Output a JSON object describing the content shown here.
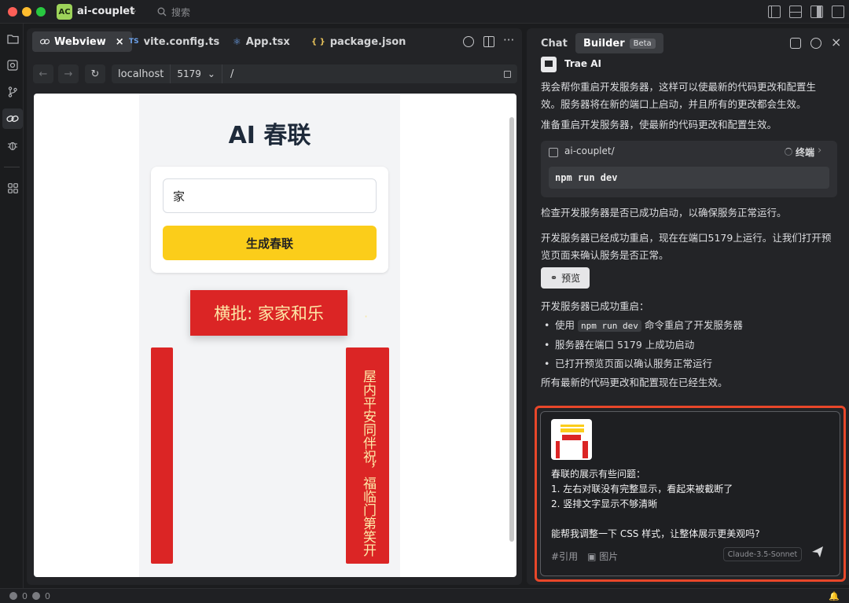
{
  "window": {
    "project_badge": "AC",
    "project_name": "ai-couplet",
    "search_placeholder": "搜索"
  },
  "editor": {
    "tabs": [
      {
        "label": "Webview",
        "icon": "link-icon",
        "active": true
      },
      {
        "label": "vite.config.ts",
        "icon": "ts-file-icon",
        "ext": "TS"
      },
      {
        "label": "App.tsx",
        "icon": "react-icon"
      },
      {
        "label": "package.json",
        "icon": "json-icon",
        "ext": "{ }"
      }
    ],
    "url": {
      "host": "localhost",
      "port": "5179",
      "path": "/"
    }
  },
  "webview": {
    "app_title": "AI 春联",
    "keyword_value": "家",
    "generate_label": "生成春联",
    "hengpi": "横批: 家家和乐",
    "right_couplet": "屋内平安同伴祝，福临门第笑开",
    "ghost_text": "·"
  },
  "panel": {
    "tab_chat": "Chat",
    "tab_builder": "Builder",
    "beta": "Beta",
    "sender": "Trae AI",
    "p1": "我会帮你重启开发服务器，这样可以使最新的代码更改和配置生效。服务器将在新的端口上启动，并且所有的更改都会生效。",
    "p2": "准备重启开发服务器，使最新的代码更改和配置生效。",
    "terminal": {
      "cwd": "ai-couplet/",
      "label": "终端",
      "command": "npm run dev"
    },
    "p3": "检查开发服务器是否已成功启动，以确保服务正常运行。",
    "p4": "开发服务器已经成功重启，现在在端口5179上运行。让我们打开预览页面来确认服务是否正常。",
    "preview_label": "预览",
    "p5": "开发服务器已成功重启：",
    "bullets": [
      {
        "pre": "使用 ",
        "code": "npm run dev",
        "post": " 命令重启了开发服务器"
      },
      {
        "pre": "服务器在端口 5179 上成功启动"
      },
      {
        "pre": "已打开预览页面以确认服务正常运行"
      }
    ],
    "p6": "所有最新的代码更改和配置现在已经生效。",
    "input": {
      "message": "春联的展示有些问题：\n1. 左右对联没有完整显示，看起来被截断了\n2. 竖排文字显示不够清晰\n\n能帮我调整一下 CSS 样式，让整体展示更美观吗?",
      "cite_label": "引用",
      "image_label": "图片",
      "model": "Claude-3.5-Sonnet"
    }
  },
  "status": {
    "errors": "0",
    "warnings": "0"
  },
  "colors": {
    "accent_red": "#db2525",
    "button_yellow": "#fbcd1a",
    "highlight_border": "#e8472a"
  }
}
